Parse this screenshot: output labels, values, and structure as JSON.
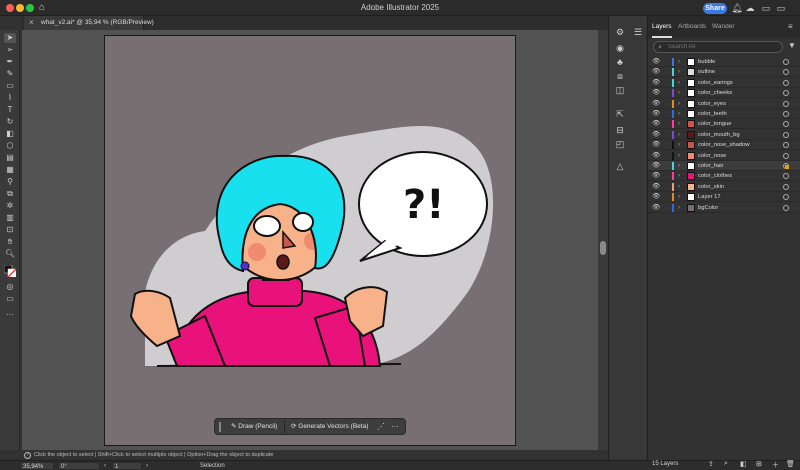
{
  "app": {
    "title": "Adobe Illustrator 2025",
    "share_label": "Share"
  },
  "colors": {
    "bg": "#323232",
    "accent": "#3b78e7",
    "artboard": "#776f72",
    "selected_square": "#e1a400"
  },
  "document": {
    "tab_title": "what_v2.ai* @ 35,94 % (RGB/Preview)",
    "close_glyph": "×"
  },
  "context_bar": {
    "draw_label": "Draw (Pencil)",
    "generate_label": "Generate Vectors (Beta)"
  },
  "hint": {
    "text": "Click the object to select  |  Shift+Click to select multiple object  |  Option+Drag the object to duplicate"
  },
  "status": {
    "zoom": "35,94%",
    "rotation": "0°",
    "artboard": "1",
    "mode": "Selection"
  },
  "panel": {
    "tabs": [
      "Layers",
      "Artboards",
      "Wander"
    ],
    "search_placeholder": "Search All",
    "layer_count": "15 Layers",
    "layers": [
      {
        "name": "bubble",
        "color": "#3b78e7",
        "thumb": "#ffffff"
      },
      {
        "name": "outline",
        "color": "#42d6e0",
        "thumb": "#dddddd"
      },
      {
        "name": "color_earings",
        "color": "#42d6e0",
        "thumb": "#ffffff"
      },
      {
        "name": "color_cheeks",
        "color": "#7a4ad8",
        "thumb": "#ffffff"
      },
      {
        "name": "color_eyes",
        "color": "#e88a1a",
        "thumb": "#ffffff"
      },
      {
        "name": "color_teeth",
        "color": "#2a6de0",
        "thumb": "#ffffff"
      },
      {
        "name": "color_tongue",
        "color": "#ff3aa0",
        "thumb": "#c9564b"
      },
      {
        "name": "color_mouth_bg",
        "color": "#7a4ad8",
        "thumb": "#5a1a1a"
      },
      {
        "name": "color_nose_shadow",
        "color": "#111111",
        "thumb": "#c9564b"
      },
      {
        "name": "color_nose",
        "color": "#111111",
        "thumb": "#f08a70"
      },
      {
        "name": "color_hair",
        "color": "#42d6e0",
        "thumb": "#ffffff"
      },
      {
        "name": "color_clothes",
        "color": "#ff3aa0",
        "thumb": "#e8127a"
      },
      {
        "name": "color_skin",
        "color": "#f0a070",
        "thumb": "#f7b28a"
      },
      {
        "name": "Layer 17",
        "color": "#e88a1a",
        "thumb": "#ffffff"
      },
      {
        "name": "bgColor",
        "color": "#2a6de0",
        "thumb": "#766e71"
      }
    ]
  },
  "artwork": {
    "bubble_text": "?!"
  },
  "icons": {
    "home": "home-icon",
    "search": "search-icon",
    "bell": "bell-icon",
    "filter": "filter-icon",
    "eye": "eye-icon"
  }
}
